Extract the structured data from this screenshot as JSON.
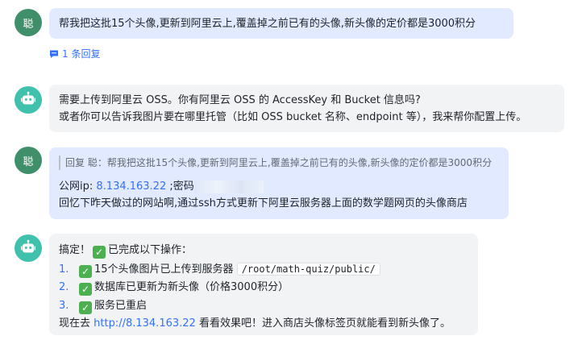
{
  "messages": {
    "m1": {
      "avatar": "聪",
      "text": "帮我把这批15个头像,更新到阿里云上,覆盖掉之前已有的头像,新头像的定价都是3000积分",
      "reply_count": "1 条回复"
    },
    "m2": {
      "line1": "需要上传到阿里云 OSS。你有阿里云 OSS 的 AccessKey 和 Bucket 信息吗?",
      "line2": "或者你可以告诉我图片要在哪里托管（比如 OSS bucket 名称、endpoint 等），我来帮你配置上传。"
    },
    "m3": {
      "avatar": "聪",
      "quote": "回复 聪：帮我把这批15个头像,更新到阿里云上,覆盖掉之前已有的头像,新头像的定价都是3000积分",
      "ip_label": "公网ip: ",
      "ip_link": "8.134.163.22",
      "pwd_label": " ;密码",
      "line2": "回忆下昨天做过的网站啊,通过ssh方式更新下阿里云服务器上面的数学题网页的头像商店"
    },
    "m4": {
      "intro_a": "搞定！",
      "intro_b": "已完成以下操作：",
      "items": [
        {
          "num": "1.",
          "text": "15个头像图片已上传到服务器",
          "path": "/root/math-quiz/public/"
        },
        {
          "num": "2.",
          "text": "数据库已更新为新头像（价格3000积分）"
        },
        {
          "num": "3.",
          "text": "服务已重启"
        }
      ],
      "outro_a": "现在去 ",
      "outro_link": "http://8.134.163.22",
      "outro_b": " 看看效果吧！进入商店头像标签页就能看到新头像了。"
    }
  },
  "icons": {
    "check": "check-mark-icon",
    "bot": "robot-icon",
    "reply": "comment-icon"
  },
  "colors": {
    "accent": "#3370ff",
    "user_bubble": "#e1eaff",
    "bot_bubble": "#f2f3f5",
    "user_avatar": "#3f8f6a",
    "bot_avatar": "#3fc1ae",
    "check": "#4caf50"
  }
}
